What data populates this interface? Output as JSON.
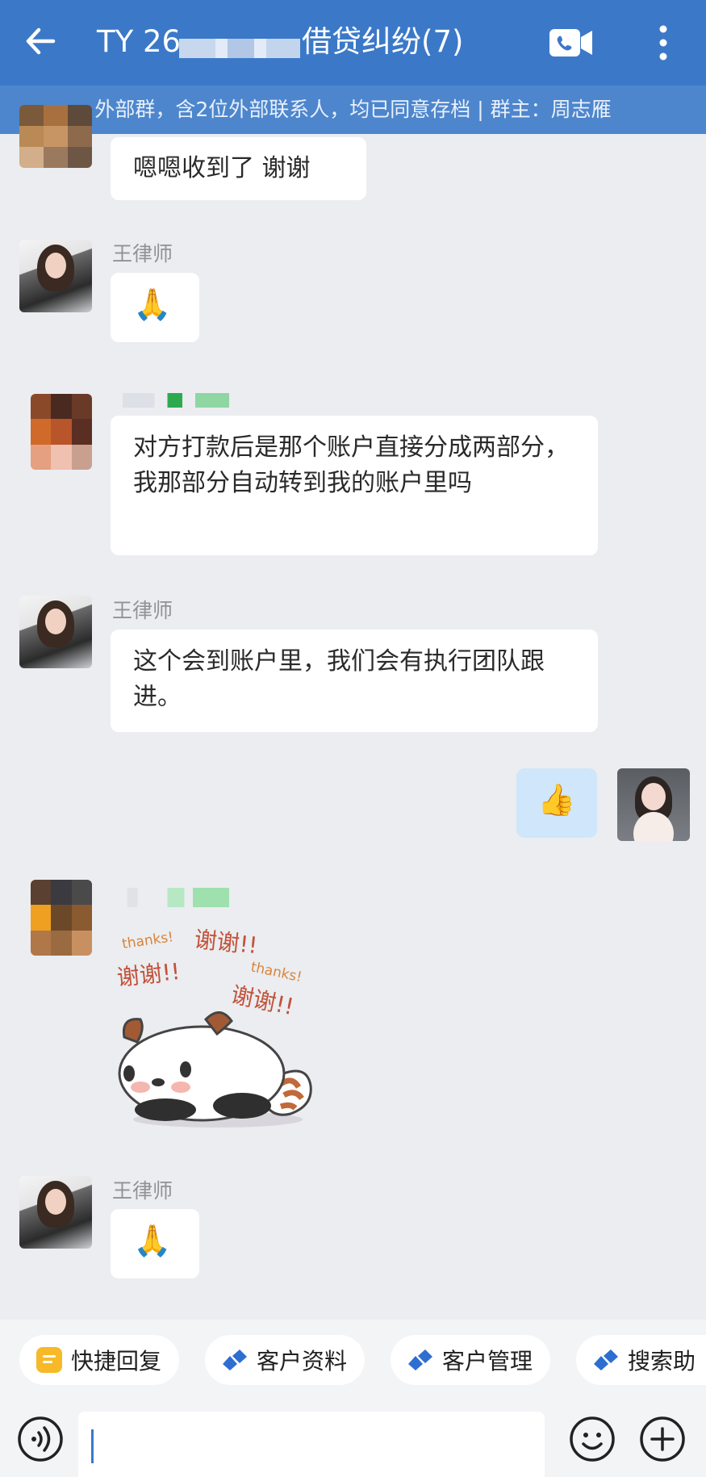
{
  "header": {
    "title_prefix": "TY 26",
    "title_suffix": "借贷纠纷(7)",
    "subtitle": "外部群，含2位外部联系人，均已同意存档 | 群主：周志雁"
  },
  "messages": [
    {
      "text": "嗯嗯收到了 谢谢"
    },
    {
      "sender": "王律师",
      "text": "🙏"
    },
    {
      "text": "对方打款后是那个账户直接分成两部分，我那部分自动转到我的账户里吗"
    },
    {
      "sender": "王律师",
      "text": "这个会到账户里，我们会有执行团队跟进。"
    },
    {
      "text": "👍"
    },
    {
      "sticker": {
        "text_1": "thanks!",
        "text_2": "谢谢!!",
        "text_3": "谢谢!!",
        "text_4": "thanks!",
        "text_5": "谢谢!!"
      }
    },
    {
      "sender": "王律师",
      "text": "🙏"
    }
  ],
  "quickbar": {
    "items": [
      {
        "label": "快捷回复",
        "icon": "quick-reply-icon"
      },
      {
        "label": "客户资料",
        "icon": "customer-icon"
      },
      {
        "label": "客户管理",
        "icon": "customer-icon"
      },
      {
        "label": "搜索助",
        "icon": "customer-icon"
      }
    ]
  },
  "colors": {
    "header": "#3b79c8",
    "subheader": "#4d86cd",
    "chat_background": "#ebedf0",
    "outgoing_bubble": "#cfe6fb"
  }
}
